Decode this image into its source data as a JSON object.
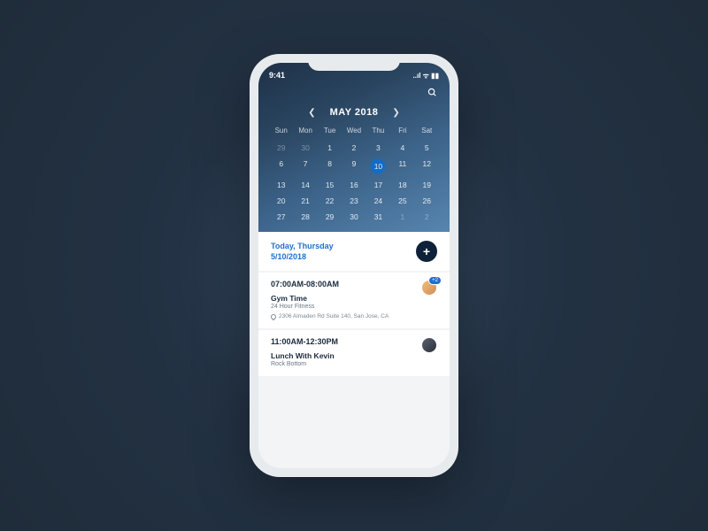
{
  "status": {
    "time": "9:41",
    "indicators": "..ıl ᯤ ▮▮"
  },
  "header": {
    "month": "MAY 2018"
  },
  "calendar": {
    "dow": [
      "Sun",
      "Mon",
      "Tue",
      "Wed",
      "Thu",
      "Fri",
      "Sat"
    ],
    "weeks": [
      [
        {
          "n": "29",
          "dim": true
        },
        {
          "n": "30",
          "dim": true
        },
        {
          "n": "1"
        },
        {
          "n": "2"
        },
        {
          "n": "3"
        },
        {
          "n": "4"
        },
        {
          "n": "5"
        }
      ],
      [
        {
          "n": "6"
        },
        {
          "n": "7"
        },
        {
          "n": "8"
        },
        {
          "n": "9"
        },
        {
          "n": "10",
          "selected": true
        },
        {
          "n": "11"
        },
        {
          "n": "12"
        }
      ],
      [
        {
          "n": "13"
        },
        {
          "n": "14"
        },
        {
          "n": "15"
        },
        {
          "n": "16"
        },
        {
          "n": "17"
        },
        {
          "n": "18"
        },
        {
          "n": "19"
        }
      ],
      [
        {
          "n": "20"
        },
        {
          "n": "21"
        },
        {
          "n": "22"
        },
        {
          "n": "23"
        },
        {
          "n": "24"
        },
        {
          "n": "25"
        },
        {
          "n": "26"
        }
      ],
      [
        {
          "n": "27"
        },
        {
          "n": "28"
        },
        {
          "n": "29"
        },
        {
          "n": "30"
        },
        {
          "n": "31"
        },
        {
          "n": "1",
          "dim": true
        },
        {
          "n": "2",
          "dim": true
        }
      ]
    ]
  },
  "today": {
    "line1": "Today, Thursday",
    "line2": "5/10/2018"
  },
  "events": [
    {
      "time": "07:00AM-08:00AM",
      "title": "Gym Time",
      "subtitle": "24 Hour Fitness",
      "location": "2306 Almaden Rd Suite 140, San Jose, CA",
      "badge": "+2"
    },
    {
      "time": "11:00AM-12:30PM",
      "title": "Lunch With Kevin",
      "subtitle": "Rock Bottom"
    }
  ]
}
